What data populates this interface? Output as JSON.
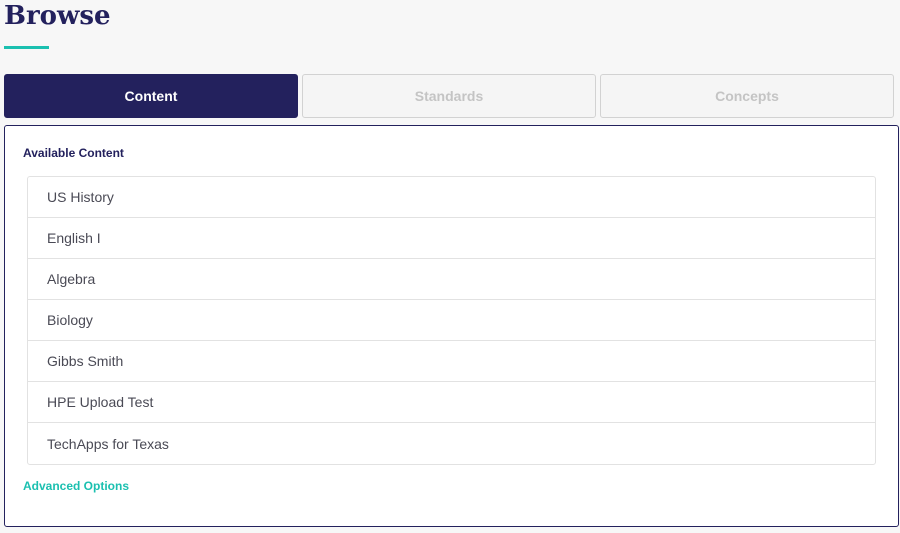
{
  "page": {
    "title": "Browse"
  },
  "tabs": [
    {
      "label": "Content",
      "active": true
    },
    {
      "label": "Standards",
      "active": false
    },
    {
      "label": "Concepts",
      "active": false
    }
  ],
  "panel": {
    "heading": "Available Content",
    "items": [
      {
        "label": "US History"
      },
      {
        "label": "English I"
      },
      {
        "label": "Algebra"
      },
      {
        "label": "Biology"
      },
      {
        "label": "Gibbs Smith"
      },
      {
        "label": "HPE Upload Test"
      },
      {
        "label": "TechApps for Texas"
      }
    ],
    "advanced_options_label": "Advanced Options"
  },
  "colors": {
    "brand_navy": "#23215d",
    "accent_teal": "#1bc0b0",
    "inactive_tab_text": "#c4c4c4"
  }
}
